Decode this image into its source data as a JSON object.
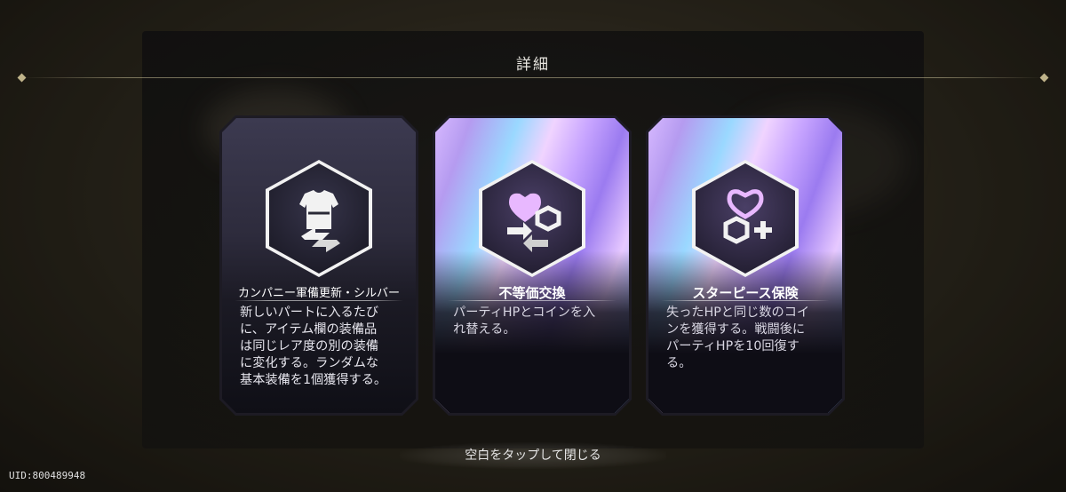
{
  "dialog": {
    "title": "詳細"
  },
  "cards": [
    {
      "name": "カンパニー軍備更新・シルバー",
      "description": "新しいパートに入るたび\nに、アイテム欄の装備品\nは同じレア度の別の装備\nに変化する。ランダムな\n基本装備を1個獲得する。",
      "icon": "armor-swap-icon",
      "style": "silver"
    },
    {
      "name": "不等価交換",
      "description": "パーティHPとコインを入\nれ替える。",
      "icon": "heart-coin-exchange-icon",
      "style": "holo"
    },
    {
      "name": "スターピース保険",
      "description": "失ったHPと同じ数のコイ\nンを獲得する。戦闘後に\nパーティHPを10回復す\nる。",
      "icon": "coin-plus-icon",
      "style": "holo"
    }
  ],
  "footer": {
    "close_hint": "空白をタップして閉じる",
    "uid": "UID:800489948"
  },
  "colors": {
    "accent_line": "#bfb38a",
    "card_frame": "#1d1b24",
    "icon_white": "#f2f2f2",
    "holo_pink": "#e8b8ff"
  }
}
